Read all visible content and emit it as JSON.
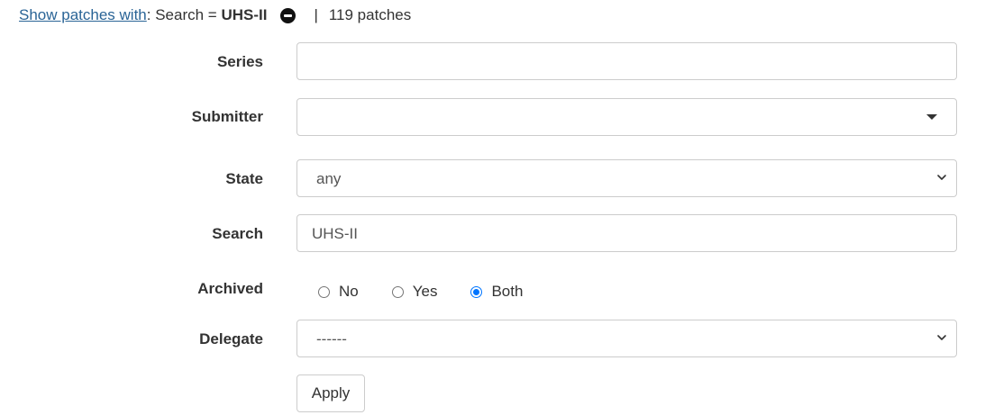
{
  "filter_bar": {
    "link_text": "Show patches with",
    "filter_prefix": ": Search = ",
    "filter_value": "UHS-II",
    "separator": "|",
    "count_text": "119 patches"
  },
  "form": {
    "series": {
      "label": "Series",
      "value": ""
    },
    "submitter": {
      "label": "Submitter",
      "value": ""
    },
    "state": {
      "label": "State",
      "value": "any"
    },
    "search": {
      "label": "Search",
      "value": "UHS-II"
    },
    "archived": {
      "label": "Archived",
      "options": [
        {
          "label": "No",
          "checked": false
        },
        {
          "label": "Yes",
          "checked": false
        },
        {
          "label": "Both",
          "checked": true
        }
      ]
    },
    "delegate": {
      "label": "Delegate",
      "value": "------"
    },
    "apply_label": "Apply"
  },
  "colors": {
    "link": "#2a6496",
    "radio_accent": "#0075ff",
    "border": "#cccccc"
  }
}
